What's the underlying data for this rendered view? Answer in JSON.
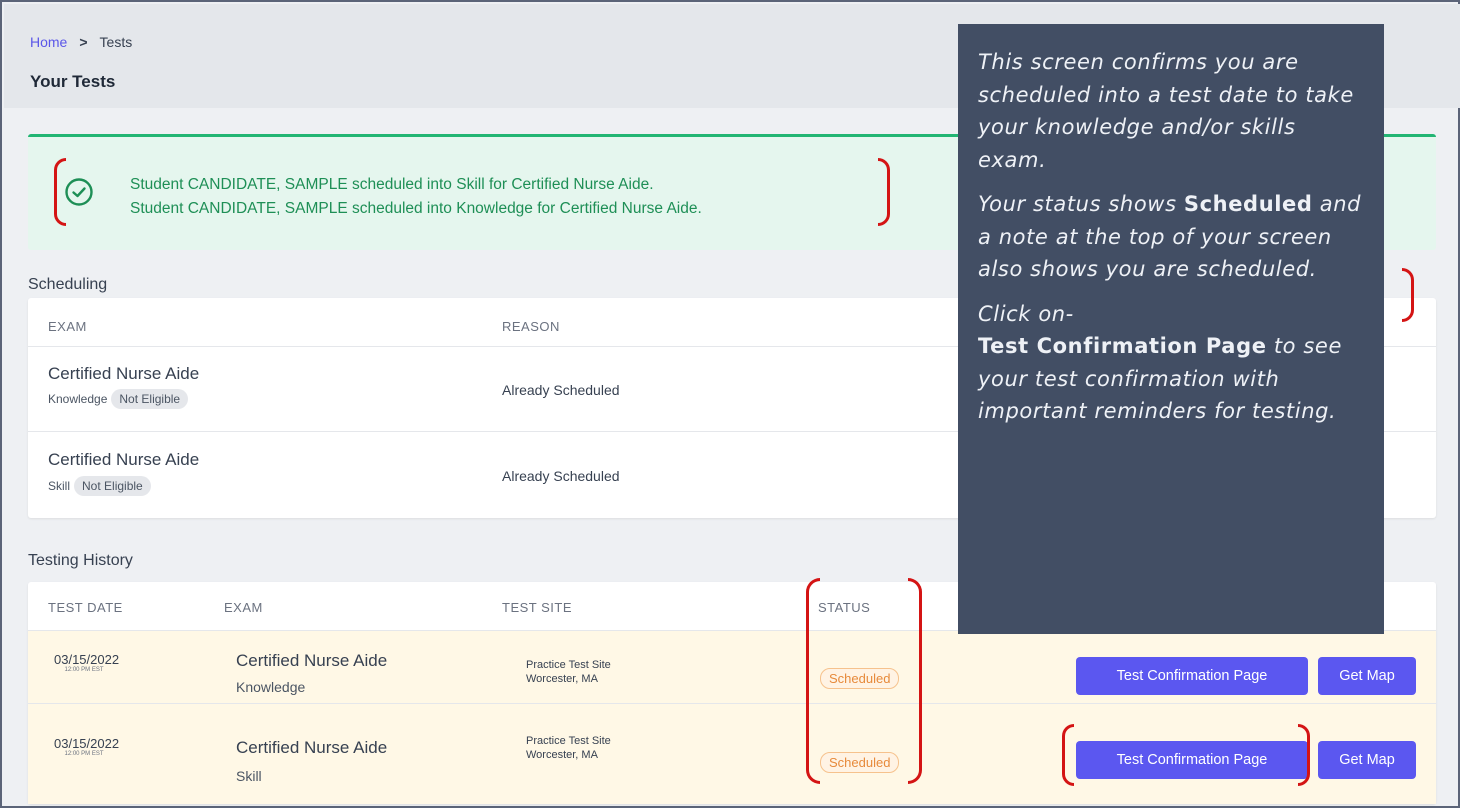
{
  "breadcrumb": {
    "home": "Home",
    "separator": ">",
    "current": "Tests"
  },
  "page_title": "Your Tests",
  "alert": {
    "line1": "Student CANDIDATE, SAMPLE scheduled into Skill for Certified Nurse Aide.",
    "line2": "Student CANDIDATE, SAMPLE scheduled into Knowledge for Certified Nurse Aide."
  },
  "scheduling": {
    "title": "Scheduling",
    "headers": {
      "exam": "EXAM",
      "reason": "REASON"
    },
    "rows": [
      {
        "exam": "Certified Nurse Aide",
        "type": "Knowledge",
        "badge": "Not Eligible",
        "reason": "Already Scheduled"
      },
      {
        "exam": "Certified Nurse Aide",
        "type": "Skill",
        "badge": "Not Eligible",
        "reason": "Already Scheduled"
      }
    ]
  },
  "history": {
    "title": "Testing History",
    "headers": {
      "test_date": "TEST DATE",
      "exam": "EXAM",
      "test_site": "TEST SITE",
      "status": "STATUS"
    },
    "rows": [
      {
        "date": "03/15/2022",
        "time": "12:00 PM EST",
        "exam": "Certified Nurse Aide",
        "type": "Knowledge",
        "site_name": "Practice Test Site",
        "site_city": "Worcester, MA",
        "status": "Scheduled",
        "confirm_label": "Test Confirmation Page",
        "map_label": "Get Map"
      },
      {
        "date": "03/15/2022",
        "time": "12:00 PM EST",
        "exam": "Certified Nurse Aide",
        "type": "Skill",
        "site_name": "Practice Test Site",
        "site_city": "Worcester, MA",
        "status": "Scheduled",
        "confirm_label": "Test Confirmation Page",
        "map_label": "Get Map"
      }
    ]
  },
  "callout": {
    "p1": "This screen confirms you are scheduled into a test date to take your knowledge and/or skills exam.",
    "p2_a": "Your status shows ",
    "p2_b": "Scheduled",
    "p2_c": " and a note at the top of your screen also shows you are scheduled.",
    "p3_a": "Click on-",
    "p3_b": "Test Confirmation Page",
    "p3_c": " to see your test confirmation with important reminders for testing."
  },
  "colors": {
    "accent": "#5b57f0",
    "success": "#1e8f56",
    "status_scheduled": "#e78a3b",
    "annotation_red": "#d41414",
    "callout_bg": "#424e64"
  },
  "icons": {
    "alert_icon": "check-circle-icon"
  }
}
